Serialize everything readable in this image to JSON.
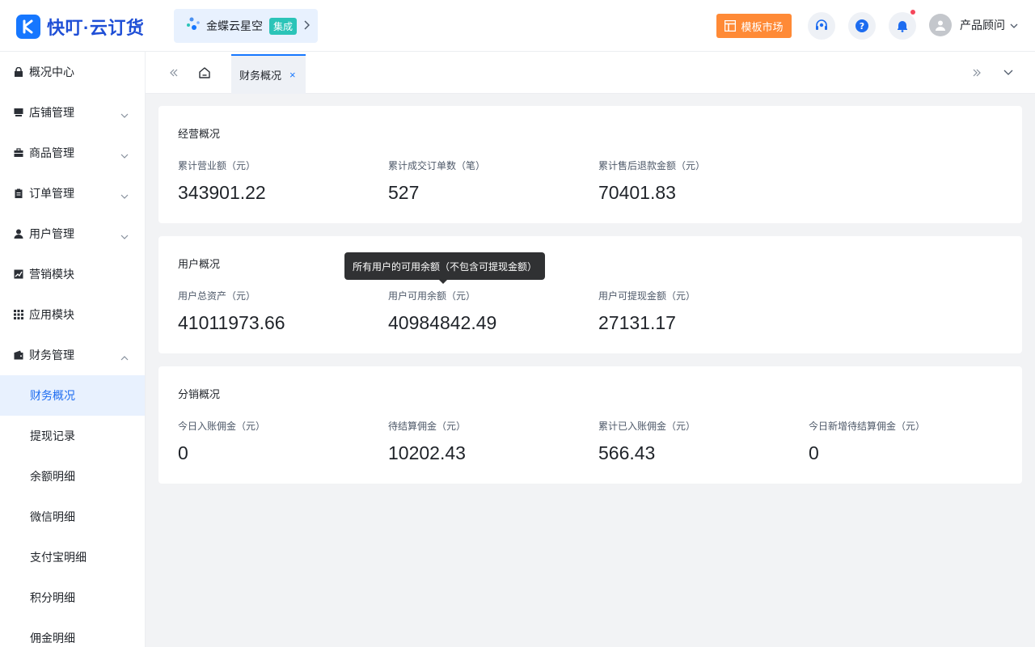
{
  "app": {
    "logo_text": "快叮·云订货"
  },
  "integration": {
    "name": "金蝶云星空",
    "tag": "集成"
  },
  "header": {
    "template_market": "模板市场",
    "user_name": "产品顾问"
  },
  "sidebar": {
    "items": [
      {
        "label": "概况中心",
        "icon": "lock-icon"
      },
      {
        "label": "店铺管理",
        "icon": "store-icon"
      },
      {
        "label": "商品管理",
        "icon": "briefcase-icon"
      },
      {
        "label": "订单管理",
        "icon": "clipboard-icon"
      },
      {
        "label": "用户管理",
        "icon": "user-icon"
      },
      {
        "label": "营销模块",
        "icon": "trend-icon"
      },
      {
        "label": "应用模块",
        "icon": "grid-icon"
      },
      {
        "label": "财务管理",
        "icon": "wallet-icon"
      }
    ],
    "sub_items": [
      {
        "label": "财务概况"
      },
      {
        "label": "提现记录"
      },
      {
        "label": "余额明细"
      },
      {
        "label": "微信明细"
      },
      {
        "label": "支付宝明细"
      },
      {
        "label": "积分明细"
      },
      {
        "label": "佣金明细"
      }
    ]
  },
  "tabs": {
    "active_label": "财务概况",
    "close": "×"
  },
  "sections": {
    "business": {
      "title": "经营概况",
      "stats": [
        {
          "label": "累计营业额（元）",
          "value": "343901.22"
        },
        {
          "label": "累计成交订单数（笔）",
          "value": "527"
        },
        {
          "label": "累计售后退款金额（元）",
          "value": "70401.83"
        }
      ]
    },
    "users": {
      "title": "用户概况",
      "stats": [
        {
          "label": "用户总资产（元）",
          "value": "41011973.66"
        },
        {
          "label": "用户可用余额（元）",
          "value": "40984842.49"
        },
        {
          "label": "用户可提现金额（元）",
          "value": "27131.17"
        }
      ]
    },
    "distribution": {
      "title": "分销概况",
      "stats": [
        {
          "label": "今日入账佣金（元）",
          "value": "0"
        },
        {
          "label": "待结算佣金（元）",
          "value": "10202.43"
        },
        {
          "label": "累计已入账佣金（元）",
          "value": "566.43"
        },
        {
          "label": "今日新增待结算佣金（元）",
          "value": "0"
        }
      ]
    }
  },
  "tooltip": {
    "text": "所有用户的可用余额（不包含可提现金额）"
  },
  "colors": {
    "primary": "#1677ff",
    "accent_orange": "#ff8a36",
    "tag_teal": "#2bc4b8"
  }
}
